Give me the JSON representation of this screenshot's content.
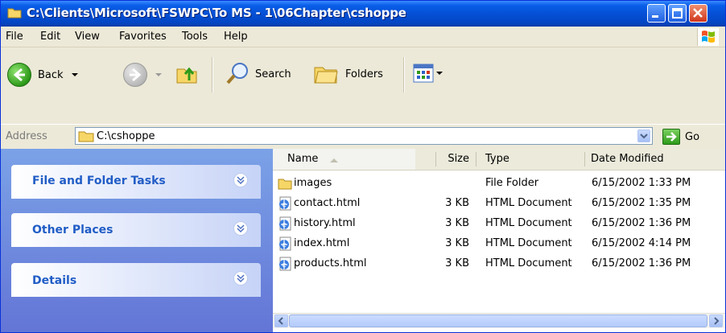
{
  "window": {
    "title": "C:\\Clients\\Microsoft\\FSWPC\\To MS - 1\\06Chapter\\cshoppe",
    "colors": {
      "titlebar": "#0550d6",
      "task_pane": "#6f8ee0",
      "panel_title": "#215dc6"
    }
  },
  "menu": [
    "File",
    "Edit",
    "View",
    "Favorites",
    "Tools",
    "Help"
  ],
  "toolbar": {
    "back_label": "Back",
    "search_label": "Search",
    "folders_label": "Folders"
  },
  "address": {
    "label": "Address",
    "value": "C:\\cshoppe",
    "go_label": "Go"
  },
  "task_pane": {
    "panels": [
      {
        "title": "File and Folder Tasks"
      },
      {
        "title": "Other Places"
      },
      {
        "title": "Details"
      }
    ]
  },
  "list": {
    "columns": {
      "name": "Name",
      "size": "Size",
      "type": "Type",
      "date": "Date Modified"
    },
    "files": [
      {
        "name": "images",
        "size": "",
        "type": "File Folder",
        "date": "6/15/2002 1:33 PM",
        "icon": "folder-icon"
      },
      {
        "name": "contact.html",
        "size": "3 KB",
        "type": "HTML Document",
        "date": "6/15/2002 1:35 PM",
        "icon": "html-document-icon"
      },
      {
        "name": "history.html",
        "size": "3 KB",
        "type": "HTML Document",
        "date": "6/15/2002 1:36 PM",
        "icon": "html-document-icon"
      },
      {
        "name": "index.html",
        "size": "3 KB",
        "type": "HTML Document",
        "date": "6/15/2002 4:14 PM",
        "icon": "html-document-icon"
      },
      {
        "name": "products.html",
        "size": "3 KB",
        "type": "HTML Document",
        "date": "6/15/2002 1:36 PM",
        "icon": "html-document-icon"
      }
    ]
  }
}
